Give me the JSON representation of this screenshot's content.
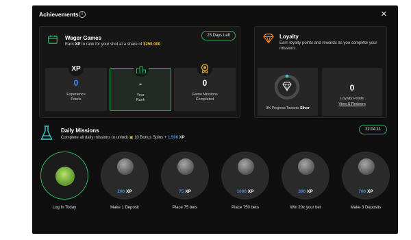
{
  "header": {
    "title": "Achievements",
    "info_icon": "info-icon",
    "close_label": "✕"
  },
  "wager": {
    "title": "Wager Games",
    "subtitle_prefix": "Earn",
    "subtitle_xp": "XP",
    "subtitle_middle": "to rank for your shot at a share of",
    "prize": "$250 000",
    "days_left": "23 Days Left",
    "stats": [
      {
        "value": "0",
        "label": "Experience\nPoints",
        "badge": "XP"
      },
      {
        "value": "-",
        "label": "Your\nRank",
        "badge": "podium-icon"
      },
      {
        "value": "0",
        "label": "Game Missions\nCompleted",
        "badge": "medal-icon"
      }
    ]
  },
  "loyalty": {
    "title": "Loyalty",
    "subtitle": "Earn loyalty points and rewards as you complete your missions.",
    "progress_percent": 0,
    "progress_prefix": "0% Progress Towards",
    "progress_tier": "Silver",
    "points_value": "0",
    "points_label": "Loyalty Points",
    "link": "View & Redeem"
  },
  "daily": {
    "title": "Daily Missions",
    "subtitle_prefix": "Complete all daily missions to unlock",
    "spins": "10 Bonus Spins +",
    "bonus_xp": "1,500",
    "xp_label": "XP",
    "timer": "22:04:11",
    "missions": [
      {
        "label": "Log In Today",
        "xp": "",
        "done": true
      },
      {
        "label": "Make 1 Deposit",
        "xp": "200",
        "done": false
      },
      {
        "label": "Place 75 bets",
        "xp": "75",
        "done": false
      },
      {
        "label": "Place 750 bets",
        "xp": "1000",
        "done": false
      },
      {
        "label": "Win 20x your bet",
        "xp": "300",
        "done": false
      },
      {
        "label": "Make 3 Deposits",
        "xp": "700",
        "done": false
      }
    ]
  },
  "colors": {
    "accent_green": "#2fb35f",
    "xp_blue": "#4c8bf5",
    "gold": "#f0c419",
    "loyalty_orange": "#f58220"
  }
}
